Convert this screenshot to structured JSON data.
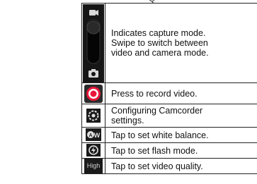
{
  "header_fragment": "Q",
  "rows": [
    {
      "icon": "capture-mode-switch-icon",
      "text_lines": [
        "Indicates capture mode.",
        "Swipe to switch between",
        "video and camera mode."
      ]
    },
    {
      "icon": "record-button-icon",
      "text_lines": [
        "Press to record video."
      ]
    },
    {
      "icon": "camcorder-settings-icon",
      "text_lines": [
        "Configuring Camcorder",
        "settings."
      ]
    },
    {
      "icon": "white-balance-icon",
      "text_lines": [
        "Tap to set white balance."
      ]
    },
    {
      "icon": "flash-mode-icon",
      "text_lines": [
        "Tap to set flash mode."
      ]
    },
    {
      "icon": "video-quality-icon",
      "icon_label": "High",
      "text_lines": [
        "Tap to set video quality."
      ]
    }
  ],
  "colors": {
    "record_red": "#e8173a",
    "icon_bg": "#1a1a1a"
  }
}
